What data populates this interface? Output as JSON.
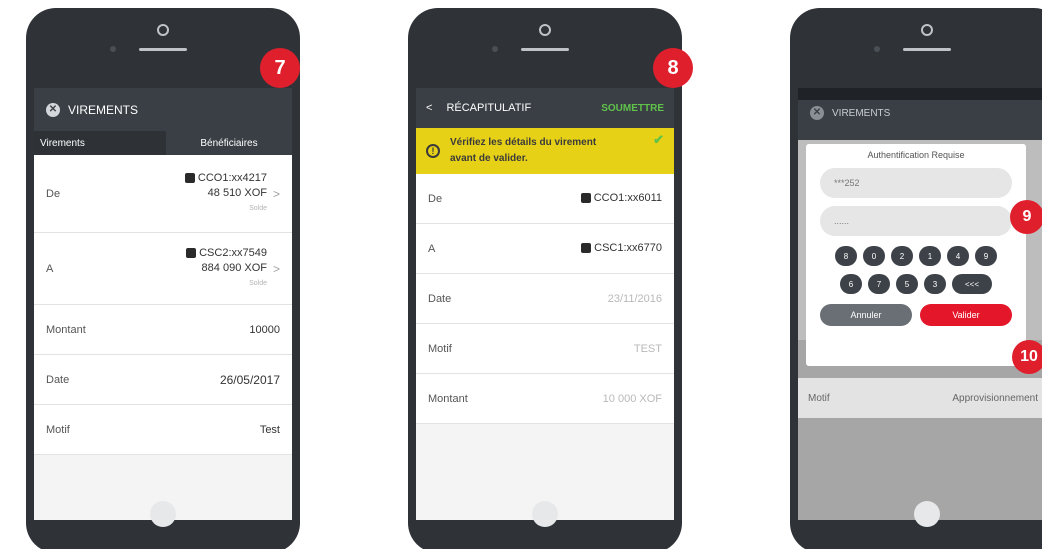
{
  "phone1": {
    "header_title": "VIREMENTS",
    "tab_virements": "Virements",
    "tab_beneficiaires": "Bénéficiaires",
    "from_label": "De",
    "from_account": "CCO1:xx4217",
    "from_balance": "48 510 XOF",
    "from_sub": "Solde",
    "to_label": "A",
    "to_account": "CSC2:xx7549",
    "to_balance": "884 090 XOF",
    "to_sub": "Solde",
    "amount_label": "Montant",
    "amount_value": "10000",
    "date_label": "Date",
    "date_value": "26/05/2017",
    "motif_label": "Motif",
    "motif_value": "Test",
    "badge": "7"
  },
  "phone2": {
    "title": "RÉCAPITULATIF",
    "submit": "SOUMETTRE",
    "alert_line1": "Vérifiez les détails du virement",
    "alert_line2": "avant de valider.",
    "from_label": "De",
    "from_account": "CCO1:xx6011",
    "to_label": "A",
    "to_account": "CSC1:xx6770",
    "date_label": "Date",
    "date_value": "23/11/2016",
    "motif_label": "Motif",
    "motif_value": "TEST",
    "amount_label": "Montant",
    "amount_value": "10 000 XOF",
    "badge": "8"
  },
  "phone3": {
    "header_title": "VIREMENTS",
    "modal_title": "Authentification Requise",
    "field1": "***252",
    "field2": "......",
    "keys_row1": [
      "8",
      "0",
      "2",
      "1",
      "4",
      "9"
    ],
    "keys_row2": [
      "6",
      "7",
      "5",
      "3",
      "<<<"
    ],
    "cancel": "Annuler",
    "confirm": "Valider",
    "motif_label": "Motif",
    "motif_value": "Approvisionnement",
    "badge9": "9",
    "badge10": "10"
  }
}
